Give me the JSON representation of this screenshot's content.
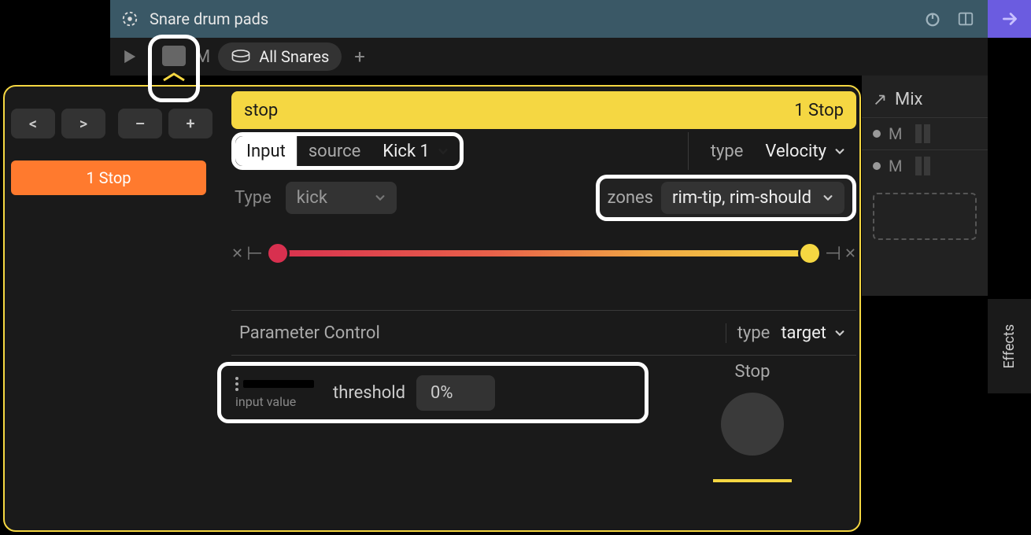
{
  "header": {
    "title": "Snare drum pads"
  },
  "toolbar": {
    "m_label": "M",
    "pill_label": "All Snares"
  },
  "right_panel": {
    "mix_title": "Mix",
    "row_m": "M"
  },
  "effects_tab": "Effects",
  "main": {
    "nav": {
      "prev": "<",
      "next": ">",
      "minus": "–",
      "plus": "+"
    },
    "tag": "1 Stop",
    "yellow": {
      "left": "stop",
      "right": "1 Stop"
    },
    "input": {
      "label": "Input",
      "source_label": "source",
      "source_value": "Kick 1",
      "type_label": "type",
      "type_value": "Velocity"
    },
    "type_row": {
      "label": "Type",
      "value": "kick",
      "zones_label": "zones",
      "zones_value": "rim-tip, rim-should"
    },
    "param": {
      "title": "Parameter Control",
      "type_label": "type",
      "type_value": "target",
      "threshold_sub": "input value",
      "threshold_label": "threshold",
      "threshold_value": "0%",
      "stop_label": "Stop"
    }
  }
}
